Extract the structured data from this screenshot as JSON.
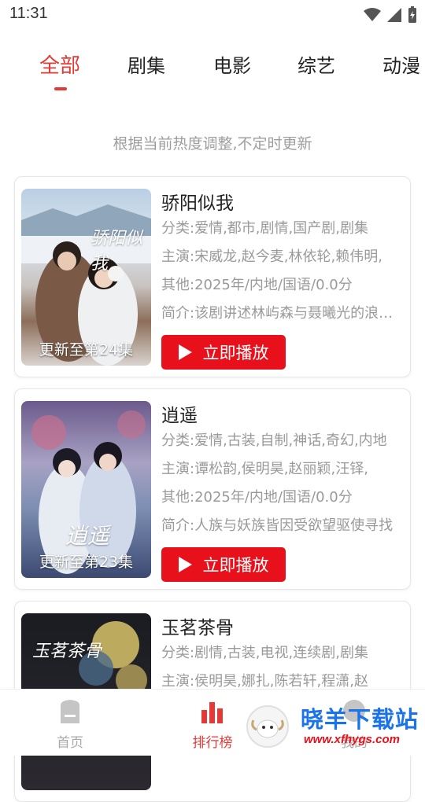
{
  "status_bar": {
    "time": "11:31"
  },
  "tabs": [
    {
      "label": "全部",
      "active": true
    },
    {
      "label": "剧集"
    },
    {
      "label": "电影"
    },
    {
      "label": "综艺"
    },
    {
      "label": "动漫"
    }
  ],
  "notice": "根据当前热度调整,不定时更新",
  "items": [
    {
      "title": "骄阳似我",
      "category": "分类:爱情,都市,剧情,国产剧,剧集",
      "cast": "主演:宋威龙,赵今麦,林依轮,赖伟明,",
      "other": "其他:2025年/内地/国语/0.0分",
      "summary": "简介:该剧讲述林屿森与聂曦光的浪漫爱情故事",
      "episode": "更新至第24集",
      "poster_title": "骄阳似我",
      "play_label": "立即播放"
    },
    {
      "title": "逍遥",
      "category": "分类:爱情,古装,自制,神话,奇幻,内地",
      "cast": "主演:谭松韵,侯明昊,赵丽颖,汪铎,",
      "other": "其他:2025年/内地/国语/0.0分",
      "summary": "简介:人族与妖族皆因受欲望驱使寻找",
      "episode": "更新至第23集",
      "poster_title": "逍遥",
      "play_label": "立即播放"
    },
    {
      "title": "玉茗茶骨",
      "category": "分类:剧情,古装,电视,连续剧,剧集",
      "cast": "主演:侯明昊,娜扎,陈若轩,程潇,赵",
      "poster_title": "玉茗茶骨"
    }
  ],
  "bottom_nav": [
    {
      "label": "首页",
      "icon": "home-icon"
    },
    {
      "label": "排行榜",
      "icon": "ranking-icon",
      "active": true
    },
    {
      "label": "我的",
      "icon": "profile-icon"
    }
  ],
  "watermark": {
    "text": "晓羊下载站",
    "url": "www.xfhygs.com"
  },
  "colors": {
    "accent": "#e53935",
    "play_button": "#e8101a"
  }
}
